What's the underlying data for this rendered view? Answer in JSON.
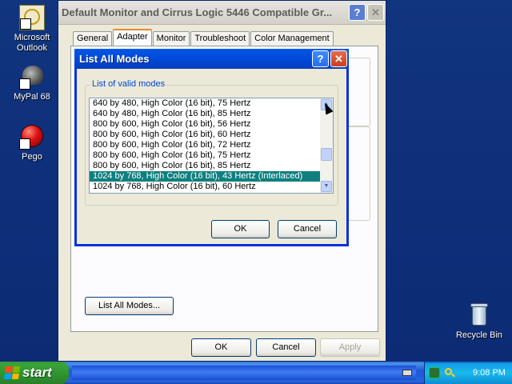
{
  "desktop": {
    "icons": [
      {
        "label": "Microsoft Outlook"
      },
      {
        "label": "MyPal 68"
      },
      {
        "label": "Pego"
      },
      {
        "label": "Recycle Bin"
      }
    ]
  },
  "props_window": {
    "title": "Default Monitor and Cirrus Logic 5446 Compatible Gr...",
    "help_glyph": "?",
    "close_glyph": "✕",
    "tabs": [
      {
        "label": "General"
      },
      {
        "label": "Adapter"
      },
      {
        "label": "Monitor"
      },
      {
        "label": "Troubleshoot"
      },
      {
        "label": "Color Management"
      }
    ],
    "active_tab": "Adapter",
    "list_all_modes_label": "List All Modes...",
    "ok_label": "OK",
    "cancel_label": "Cancel",
    "apply_label": "Apply"
  },
  "dialog": {
    "title": "List All Modes",
    "help_glyph": "?",
    "close_glyph": "✕",
    "group_label": "List of valid modes",
    "modes": [
      "640 by 480, High Color (16 bit), 75 Hertz",
      "640 by 480, High Color (16 bit), 85 Hertz",
      "800 by 600, High Color (16 bit), 56 Hertz",
      "800 by 600, High Color (16 bit), 60 Hertz",
      "800 by 600, High Color (16 bit), 72 Hertz",
      "800 by 600, High Color (16 bit), 75 Hertz",
      "800 by 600, High Color (16 bit), 85 Hertz",
      "1024 by 768, High Color (16 bit), 43 Hertz (Interlaced)",
      "1024 by 768, High Color (16 bit), 60 Hertz"
    ],
    "selected_mode": "1024 by 768, High Color (16 bit), 43 Hertz (Interlaced)",
    "scroll_up_glyph": "▲",
    "scroll_down_glyph": "▼",
    "ok_label": "OK",
    "cancel_label": "Cancel"
  },
  "taskbar": {
    "start_label": "start",
    "clock": "9:08 PM"
  },
  "colors": {
    "selection": "#0f7f7f",
    "dialog_title": "#0054e3",
    "desktop": "#0e2f7a"
  }
}
